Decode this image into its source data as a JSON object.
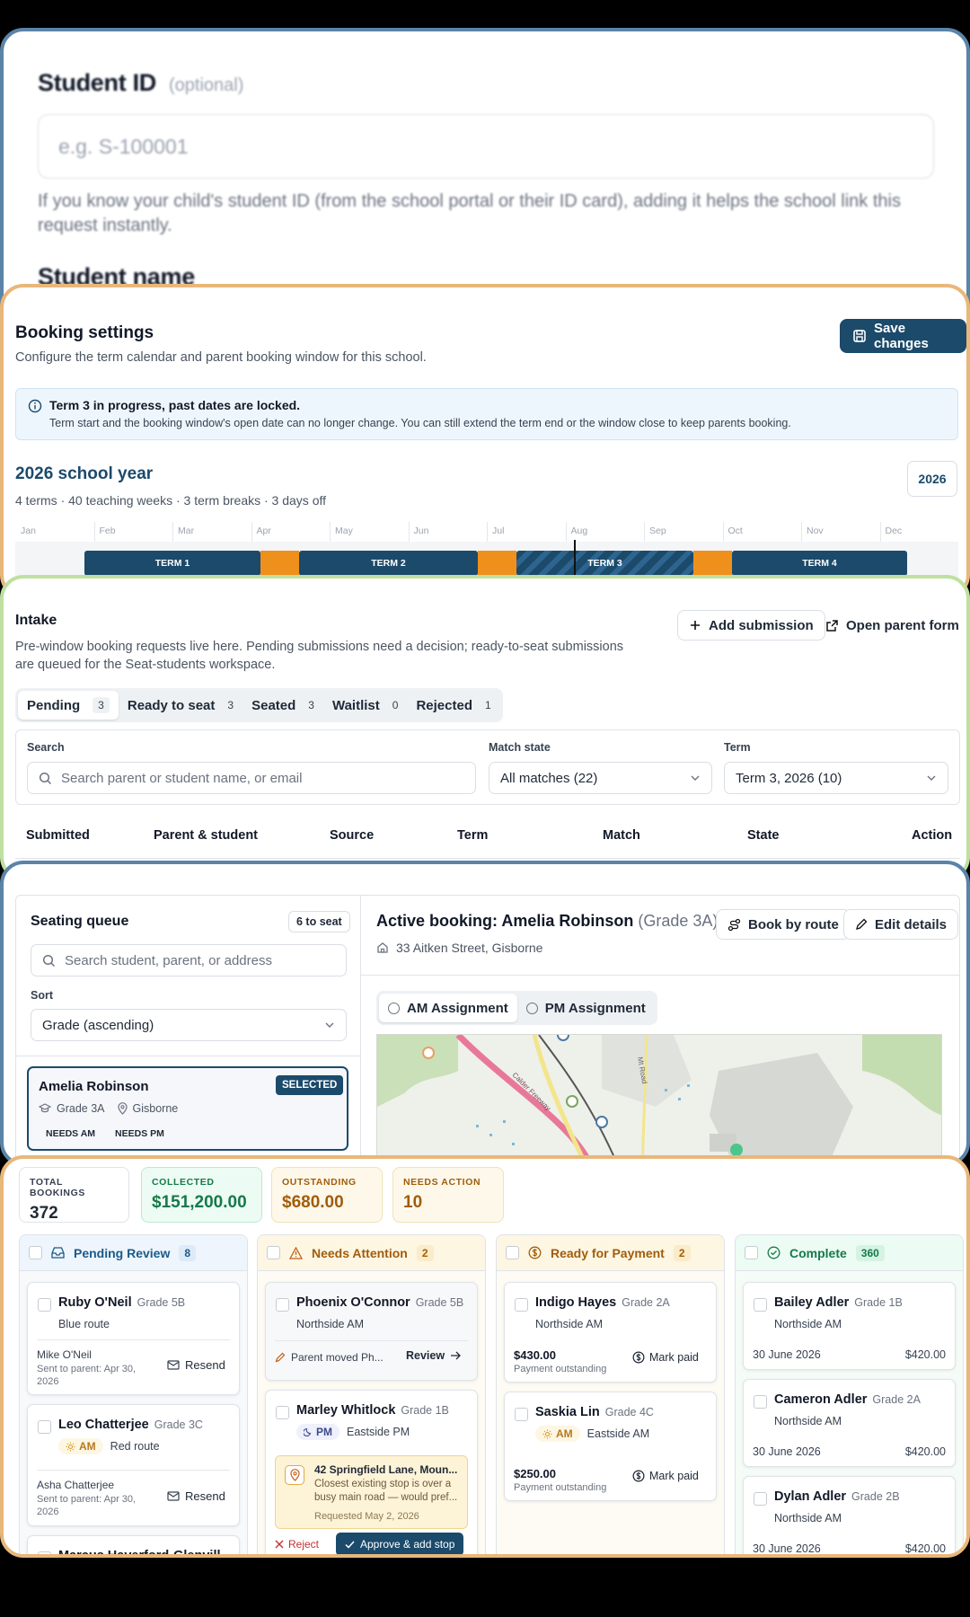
{
  "form": {
    "student_id_label": "Student ID",
    "student_id_optional": "(optional)",
    "student_id_placeholder": "e.g. S-100001",
    "student_id_help": "If you know your child's student ID (from the school portal or their ID card), adding it helps the school link this request instantly.",
    "student_name_label": "Student name"
  },
  "booking": {
    "title": "Booking settings",
    "subtitle": "Configure the term calendar and parent booking window for this school.",
    "save_label": "Save changes",
    "alert_title": "Term 3 in progress, past dates are locked.",
    "alert_body": "Term start and the booking window's open date can no longer change. You can still extend the term end or the window close to keep parents booking.",
    "year_title": "2026 school year",
    "year_summary": "4 terms · 40 teaching weeks · 3 term breaks · 3 days off",
    "year_select": "2026",
    "months": [
      "Jan",
      "Feb",
      "Mar",
      "Apr",
      "May",
      "Jun",
      "Jul",
      "Aug",
      "Sep",
      "Oct",
      "Nov",
      "Dec"
    ],
    "terms": [
      "TERM 1",
      "TERM 2",
      "TERM 3",
      "TERM 4"
    ]
  },
  "intake": {
    "title": "Intake",
    "description": "Pre-window booking requests live here. Pending submissions need a decision; ready-to-seat submissions are queued for the Seat-students workspace.",
    "add_label": "Add submission",
    "open_form_label": "Open parent form",
    "tabs": [
      {
        "label": "Pending",
        "count": "3"
      },
      {
        "label": "Ready to seat",
        "count": "3"
      },
      {
        "label": "Seated",
        "count": "3"
      },
      {
        "label": "Waitlist",
        "count": "0"
      },
      {
        "label": "Rejected",
        "count": "1"
      }
    ],
    "search_label": "Search",
    "search_placeholder": "Search parent or student name, or email",
    "match_label": "Match state",
    "match_value": "All matches (22)",
    "term_label": "Term",
    "term_value": "Term 3, 2026 (10)",
    "columns": [
      "Submitted",
      "Parent & student",
      "Source",
      "Term",
      "Match",
      "State",
      "Action"
    ]
  },
  "seating": {
    "queue_title": "Seating queue",
    "queue_badge": "6 to seat",
    "search_placeholder": "Search student, parent, or address",
    "sort_label": "Sort",
    "sort_value": "Grade (ascending)",
    "student": {
      "name": "Amelia Robinson",
      "badge": "SELECTED",
      "grade": "Grade 3A",
      "town": "Gisborne",
      "tag_am": "NEEDS AM",
      "tag_pm": "NEEDS PM"
    },
    "active_title": "Active booking: Amelia Robinson",
    "active_grade": "(Grade 3A)",
    "address": "33 Aitken Street, Gisborne",
    "book_route_label": "Book by route",
    "edit_label": "Edit details",
    "am_tab": "AM Assignment",
    "pm_tab": "PM Assignment",
    "map_road_label": "Calder Freeway",
    "map_road_label2": "Mt Road"
  },
  "payments": {
    "stats": [
      {
        "title": "TOTAL BOOKINGS",
        "value": "372"
      },
      {
        "title": "COLLECTED",
        "value": "$151,200.00"
      },
      {
        "title": "OUTSTANDING",
        "value": "$680.00"
      },
      {
        "title": "NEEDS ACTION",
        "value": "10"
      }
    ],
    "columns": [
      {
        "title": "Pending Review",
        "count": "8"
      },
      {
        "title": "Needs Attention",
        "count": "2"
      },
      {
        "title": "Ready for Payment",
        "count": "2"
      },
      {
        "title": "Complete",
        "count": "360"
      }
    ],
    "pending": [
      {
        "name": "Ruby O'Neil",
        "grade": "Grade 5B",
        "route": "Blue route",
        "parent": "Mike O'Neil",
        "sent": "Sent to parent: Apr 30, 2026",
        "action": "Resend"
      },
      {
        "name": "Leo Chatterjee",
        "grade": "Grade 3C",
        "shift": "AM",
        "route": "Red route",
        "parent": "Asha Chatterjee",
        "sent": "Sent to parent: Apr 30, 2026",
        "action": "Resend"
      },
      {
        "name": "Marcus Haverford-Glenvill..."
      }
    ],
    "attention": [
      {
        "name": "Phoenix O'Connor",
        "grade": "Grade 5B",
        "route": "Northside AM",
        "note": "Parent moved Ph...",
        "action": "Review"
      },
      {
        "name": "Marley Whitlock",
        "grade": "Grade 1B",
        "shift": "PM",
        "route": "Eastside PM",
        "alert_title": "42 Springfield Lane, Moun...",
        "alert_body": "Closest existing stop is over a busy main road — would pref...",
        "alert_date": "Requested May 2, 2026",
        "reject": "Reject",
        "approve": "Approve & add stop"
      }
    ],
    "ready": [
      {
        "name": "Indigo Hayes",
        "grade": "Grade 2A",
        "route": "Northside AM",
        "amount": "$430.00",
        "status": "Payment outstanding",
        "action": "Mark paid"
      },
      {
        "name": "Saskia Lin",
        "grade": "Grade 4C",
        "shift": "AM",
        "route": "Eastside AM",
        "amount": "$250.00",
        "status": "Payment outstanding",
        "action": "Mark paid"
      }
    ],
    "complete": [
      {
        "name": "Bailey Adler",
        "grade": "Grade 1B",
        "route": "Northside AM",
        "date": "30 June 2026",
        "amount": "$420.00"
      },
      {
        "name": "Cameron Adler",
        "grade": "Grade 2A",
        "route": "Northside AM",
        "date": "30 June 2026",
        "amount": "$420.00"
      },
      {
        "name": "Dylan Adler",
        "grade": "Grade 2B",
        "route": "Northside AM",
        "date": "30 June 2026",
        "amount": "$420.00"
      }
    ]
  }
}
